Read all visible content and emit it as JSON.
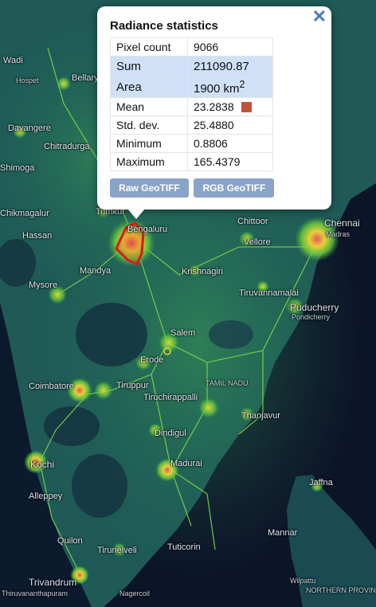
{
  "popup": {
    "title": "Radiance statistics",
    "close": "✕",
    "rows": [
      {
        "label": "Pixel count",
        "value": "9066"
      },
      {
        "label": "Sum",
        "value": "211090.87"
      },
      {
        "label": "Area",
        "value": "1900 km",
        "sup": "2"
      },
      {
        "label": "Mean",
        "value": "23.2838"
      },
      {
        "label": "Std. dev.",
        "value": "25.4880"
      },
      {
        "label": "Minimum",
        "value": "0.8806"
      },
      {
        "label": "Maximum",
        "value": "165.4379"
      }
    ],
    "mean_color": "#c0533c",
    "buttons": {
      "raw": "Raw GeoTIFF",
      "rgb": "RGB GeoTIFF"
    }
  },
  "map": {
    "places": {
      "wadi": "Wadi",
      "bellary": "Bellary",
      "hospet": "Hospet",
      "davangere": "Davangere",
      "chitradurga": "Chitradurga",
      "shimoga": "Shimoga",
      "chikmagalur": "Chikmagalur",
      "tumkur": "Tumkur",
      "hassan": "Hassan",
      "bangalore": "Bengaluru",
      "mandya": "Mandya",
      "mysore": "Mysore",
      "krishnagiri": "Krishnagiri",
      "chittoor": "Chittoor",
      "vellore": "Vellore",
      "chennai": "Chennai",
      "madras": "Madras",
      "tiruvannamalai": "Tiruvannamalai",
      "puducherry": "Puducherry",
      "pondicherry": "Pondicherry",
      "salem": "Salem",
      "erode": "Erode",
      "tamil_nadu": "TAMIL NADU",
      "coimbatore": "Coimbatore",
      "tiruppur": "Tiruppur",
      "tiruchirappalli": "Tiruchirappalli",
      "thanjavur": "Thanjavur",
      "dindigul": "Dindigul",
      "madurai": "Madurai",
      "kochi": "Kochi",
      "alleppey": "Alleppey",
      "quilon": "Quilon",
      "tirunelveli": "Tirunelveli",
      "tuticorin": "Tuticorin",
      "trivandrum": "Trivandrum",
      "thiruvananthapuram": "Thiruvananthapuram",
      "nagercoil": "Nagercoil",
      "jaffna": "Jaffna",
      "mannar": "Mannar",
      "wilpattu": "Wilpattu",
      "northern_province": "NORTHERN PROVINCE"
    },
    "colors": {
      "bright": "#e8d33a",
      "medium": "#5fcf3a",
      "dim": "#2a8a4f",
      "core": "#d04a4a",
      "selection": "#e01818"
    }
  }
}
